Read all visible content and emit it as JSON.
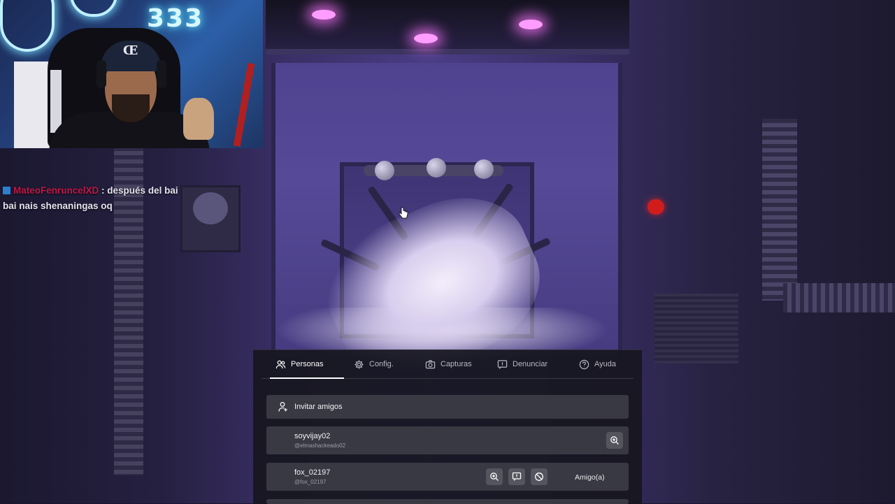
{
  "webcam": {
    "neon_text": "333",
    "cap_logo": "Œ"
  },
  "chat": {
    "username": "MateoFenruncelXD",
    "separator": ":",
    "message": " después del bai bai nais shenaningas oq"
  },
  "menu": {
    "tabs": [
      {
        "label": "Personas",
        "icon": "people-icon",
        "active": true
      },
      {
        "label": "Config.",
        "icon": "gear-icon",
        "active": false
      },
      {
        "label": "Capturas",
        "icon": "camera-icon",
        "active": false
      },
      {
        "label": "Denunciar",
        "icon": "report-icon",
        "active": false
      },
      {
        "label": "Ayuda",
        "icon": "help-icon",
        "active": false
      }
    ],
    "invite_label": "Invitar amigos",
    "friends": [
      {
        "name": "soyvijay02",
        "handle": "@elmashackeado02",
        "status": ""
      },
      {
        "name": "fox_02197",
        "handle": "@fox_02197",
        "status": "Amigo(a)"
      }
    ]
  },
  "colors": {
    "menu_bg": "#16161e",
    "row_bg": "#393943",
    "active_tab": "#ffffff",
    "scene_purple": "#4a3d86"
  }
}
